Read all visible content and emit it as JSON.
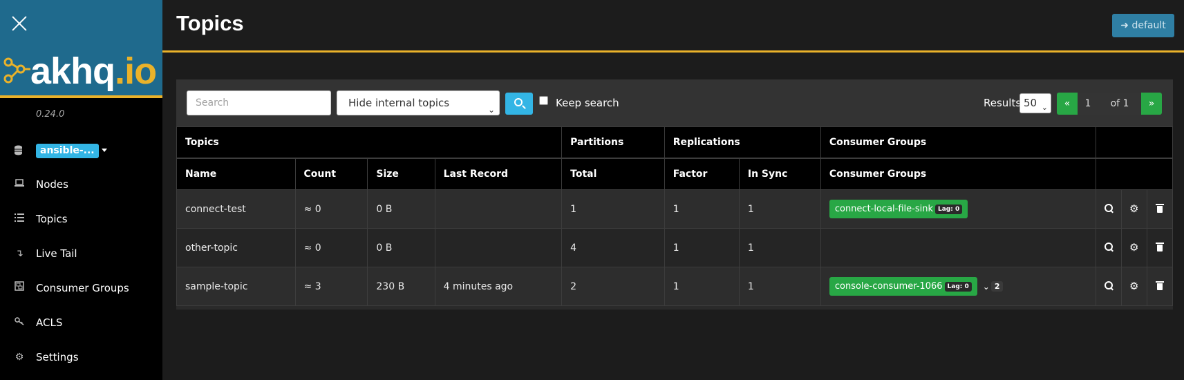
{
  "sidebar": {
    "logo_main": "akhq",
    "logo_dot": ".",
    "logo_io": "io",
    "version": "0.24.0",
    "cluster": "ansible-...",
    "items": [
      {
        "icon": "laptop-icon",
        "glyph": "💻",
        "label": "Nodes"
      },
      {
        "icon": "list-icon",
        "glyph": "☰",
        "label": "Topics"
      },
      {
        "icon": "level-down-icon",
        "glyph": "↴",
        "label": "Live Tail"
      },
      {
        "icon": "object-group-icon",
        "glyph": "▣",
        "label": "Consumer Groups"
      },
      {
        "icon": "key-icon",
        "glyph": "⚷",
        "label": "ACLS"
      },
      {
        "icon": "gear-icon",
        "glyph": "⚙",
        "label": "Settings"
      }
    ]
  },
  "header": {
    "title": "Topics",
    "user_button": "default",
    "user_icon": "sign-in-icon"
  },
  "toolbar": {
    "search_placeholder": "Search",
    "search_value": "",
    "filter_selected": "Hide internal topics",
    "keep_search_label": "Keep search",
    "keep_search_checked": false,
    "results_label": "Results",
    "results_per_page": "50",
    "pagination": {
      "prev": "«",
      "page": "1",
      "of": "of 1",
      "next": "»"
    }
  },
  "table": {
    "group_headers": [
      "Topics",
      "Partitions",
      "Replications",
      "Consumer Groups",
      ""
    ],
    "columns": [
      "Name",
      "Count",
      "Size",
      "Last Record",
      "Total",
      "Factor",
      "In Sync",
      "Consumer Groups"
    ],
    "rows": [
      {
        "name": "connect-test",
        "count": "≈ 0",
        "size": "0 B",
        "last_record": "",
        "total": "1",
        "factor": "1",
        "in_sync": "1",
        "consumer_group": "connect-local-file-sink",
        "lag": "Lag: 0",
        "more": ""
      },
      {
        "name": "other-topic",
        "count": "≈ 0",
        "size": "0 B",
        "last_record": "",
        "total": "4",
        "factor": "1",
        "in_sync": "1",
        "consumer_group": "",
        "lag": "",
        "more": ""
      },
      {
        "name": "sample-topic",
        "count": "≈ 3",
        "size": "230 B",
        "last_record": "4 minutes ago",
        "total": "2",
        "factor": "1",
        "in_sync": "1",
        "consumer_group": "console-consumer-1066",
        "lag": "Lag: 0",
        "more": "2"
      }
    ]
  },
  "colors": {
    "accent_yellow": "#eab22a",
    "brand_blue": "#1f6a8d",
    "info_blue": "#33b5e5",
    "success_green": "#28a745"
  }
}
